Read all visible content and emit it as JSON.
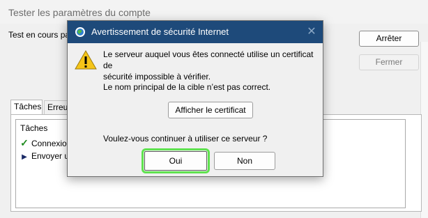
{
  "background_window": {
    "title": "Tester les paramètres du compte",
    "status": "Test en cours pa",
    "stop_button": "Arrêter",
    "close_button": "Fermer",
    "tabs": [
      "Tâches",
      "Erreur"
    ],
    "task_list": {
      "header": "Tâches",
      "rows": [
        {
          "icon": "checkmark-icon",
          "label": "Connexion"
        },
        {
          "icon": "play-triangle-icon",
          "label": "Envoyer u"
        }
      ]
    }
  },
  "dialog": {
    "title": "Avertissement de sécurité Internet",
    "close_glyph": "✕",
    "message_line1": "Le serveur auquel vous êtes connecté utilise un certificat de",
    "message_line2": "sécurité impossible à vérifier.",
    "message_name": "Le nom principal de la cible n’est pas correct.",
    "view_certificate_button": "Afficher le certificat",
    "question": "Voulez-vous continuer à utiliser ce serveur ?",
    "yes_button": "Oui",
    "no_button": "Non"
  },
  "colors": {
    "dialog_titlebar": "#1e4a7a",
    "highlight": "#5fe24f",
    "warning_yellow": "#f5c518"
  }
}
